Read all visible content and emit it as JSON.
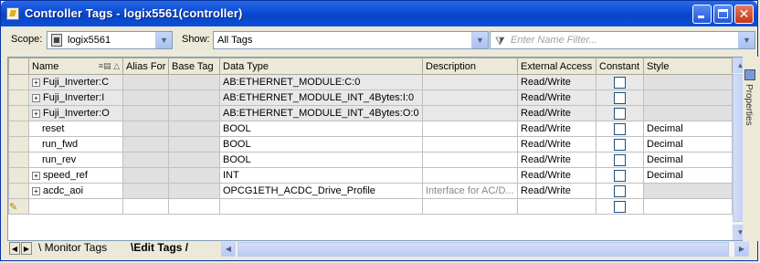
{
  "window": {
    "title": "Controller Tags - logix5561(controller)"
  },
  "toolbar": {
    "scope_label": "Scope:",
    "scope_value": "logix5561",
    "show_label": "Show:",
    "show_value": "All Tags",
    "filter_placeholder": "Enter Name Filter..."
  },
  "columns": [
    "Name",
    "Alias For",
    "Base Tag",
    "Data Type",
    "Description",
    "External Access",
    "Constant",
    "Style"
  ],
  "rows": [
    {
      "name": "Fuji_Inverter:C",
      "expand": "+",
      "data_type": "AB:ETHERNET_MODULE:C:0",
      "description": "",
      "external_access": "Read/Write",
      "style": ""
    },
    {
      "name": "Fuji_Inverter:I",
      "expand": "+",
      "data_type": "AB:ETHERNET_MODULE_INT_4Bytes:I:0",
      "description": "",
      "external_access": "Read/Write",
      "style": ""
    },
    {
      "name": "Fuji_Inverter:O",
      "expand": "+",
      "data_type": "AB:ETHERNET_MODULE_INT_4Bytes:O:0",
      "description": "",
      "external_access": "Read/Write",
      "style": ""
    },
    {
      "name": "reset",
      "expand": "",
      "data_type": "BOOL",
      "description": "",
      "external_access": "Read/Write",
      "style": "Decimal"
    },
    {
      "name": "run_fwd",
      "expand": "",
      "data_type": "BOOL",
      "description": "",
      "external_access": "Read/Write",
      "style": "Decimal"
    },
    {
      "name": "run_rev",
      "expand": "",
      "data_type": "BOOL",
      "description": "",
      "external_access": "Read/Write",
      "style": "Decimal"
    },
    {
      "name": "speed_ref",
      "expand": "+",
      "data_type": "INT",
      "description": "",
      "external_access": "Read/Write",
      "style": "Decimal"
    },
    {
      "name": "acdc_aoi",
      "expand": "+",
      "data_type": "OPCG1ETH_ACDC_Drive_Profile",
      "description": "Interface for AC/D...",
      "external_access": "Read/Write",
      "style": ""
    }
  ],
  "side_panel": {
    "label": "Properties"
  },
  "tabs": {
    "monitor": "Monitor Tags",
    "edit": "Edit Tags"
  },
  "icons": {
    "title": "app-icon",
    "scope": "controller-icon",
    "filter": "filter-icon",
    "new_row": "pencil-icon",
    "properties": "properties-icon"
  }
}
